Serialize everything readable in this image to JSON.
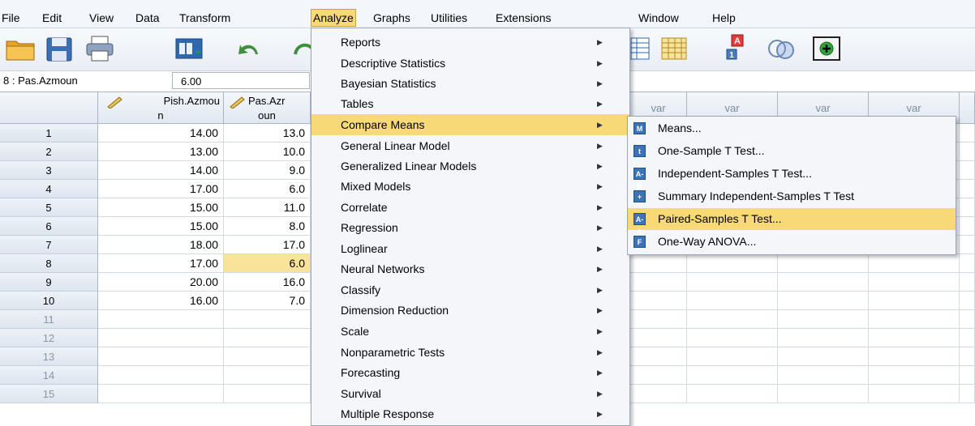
{
  "menubar": [
    "File",
    "Edit",
    "View",
    "Data",
    "Transform",
    "Analyze",
    "Graphs",
    "Utilities",
    "Extensions",
    "Window",
    "Help"
  ],
  "cell_ref": {
    "name": "8 : Pas.Azmoun",
    "value": "6.00"
  },
  "grid": {
    "col1_header": [
      "Pish.Azmou",
      "n"
    ],
    "col2_header": [
      "Pas.Azr",
      "oun"
    ],
    "var_label": "var",
    "rows": [
      {
        "n": "1",
        "a": "14.00",
        "b": "13.0"
      },
      {
        "n": "2",
        "a": "13.00",
        "b": "10.0"
      },
      {
        "n": "3",
        "a": "14.00",
        "b": "9.0"
      },
      {
        "n": "4",
        "a": "17.00",
        "b": "6.0"
      },
      {
        "n": "5",
        "a": "15.00",
        "b": "11.0"
      },
      {
        "n": "6",
        "a": "15.00",
        "b": "8.0"
      },
      {
        "n": "7",
        "a": "18.00",
        "b": "17.0"
      },
      {
        "n": "8",
        "a": "17.00",
        "b": "6.0"
      },
      {
        "n": "9",
        "a": "20.00",
        "b": "16.0"
      },
      {
        "n": "10",
        "a": "16.00",
        "b": "7.0"
      },
      {
        "n": "11",
        "a": "",
        "b": ""
      },
      {
        "n": "12",
        "a": "",
        "b": ""
      },
      {
        "n": "13",
        "a": "",
        "b": ""
      },
      {
        "n": "14",
        "a": "",
        "b": ""
      },
      {
        "n": "15",
        "a": "",
        "b": ""
      }
    ]
  },
  "analyze_menu": [
    "Reports",
    "Descriptive Statistics",
    "Bayesian Statistics",
    "Tables",
    "Compare Means",
    "General Linear Model",
    "Generalized Linear Models",
    "Mixed Models",
    "Correlate",
    "Regression",
    "Loglinear",
    "Neural Networks",
    "Classify",
    "Dimension Reduction",
    "Scale",
    "Nonparametric Tests",
    "Forecasting",
    "Survival",
    "Multiple Response"
  ],
  "compare_means_menu": [
    {
      "label": "Means...",
      "icon": "M"
    },
    {
      "label": "One-Sample T Test...",
      "icon": "t"
    },
    {
      "label": "Independent-Samples T Test...",
      "icon": "A-B"
    },
    {
      "label": "Summary Independent-Samples T Test",
      "icon": "+"
    },
    {
      "label": "Paired-Samples T Test...",
      "icon": "A-A"
    },
    {
      "label": "One-Way ANOVA...",
      "icon": "F"
    }
  ],
  "colors": {
    "highlight": "#f7d977",
    "icon_blue": "#3d74b8"
  }
}
